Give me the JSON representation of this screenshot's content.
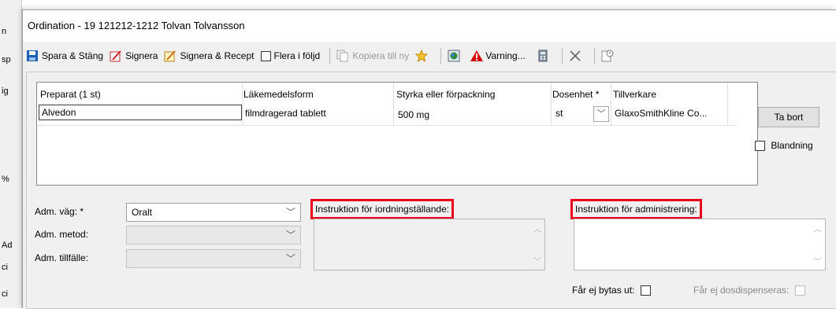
{
  "background": {
    "labels": [
      "n",
      "sp",
      "ig",
      "%",
      "Ad",
      "ci",
      "ci"
    ]
  },
  "window": {
    "title": "Ordination - 19 121212-1212 Tolvan Tolvansson"
  },
  "toolbar": {
    "save_close": "Spara & Stäng",
    "sign": "Signera",
    "sign_recipe": "Signera & Recept",
    "several": "Flera i följd",
    "copy_new": "Kopiera till ny",
    "warning": "Varning..."
  },
  "grid": {
    "headers": {
      "preparat": "Preparat (1 st)",
      "form": "Läkemedelsform",
      "strength": "Styrka eller förpackning",
      "unit": "Dosenhet *",
      "manufacturer": "Tillverkare"
    },
    "row": {
      "preparat": "Alvedon",
      "form": "filmdragerad tablett",
      "strength": "500 mg",
      "unit": "st",
      "manufacturer": "GlaxoSmithKline Co..."
    }
  },
  "side": {
    "remove": "Ta bort",
    "mix": "Blandning"
  },
  "adm": {
    "route_label": "Adm. väg: *",
    "route_value": "Oralt",
    "method_label": "Adm. metod:",
    "method_value": "",
    "occasion_label": "Adm. tillfälle:",
    "occasion_value": ""
  },
  "instructions": {
    "prep_label": "Instruktion för iordningställande:",
    "admin_label": "Instruktion för administrering:"
  },
  "footer": {
    "no_swap": "Får ej bytas ut:",
    "no_dispense": "Får ej dosdispenseras:"
  },
  "colors": {
    "highlight": "#e8001c",
    "save_icon": "#1e5fb4",
    "warning_icon": "#d40000"
  }
}
